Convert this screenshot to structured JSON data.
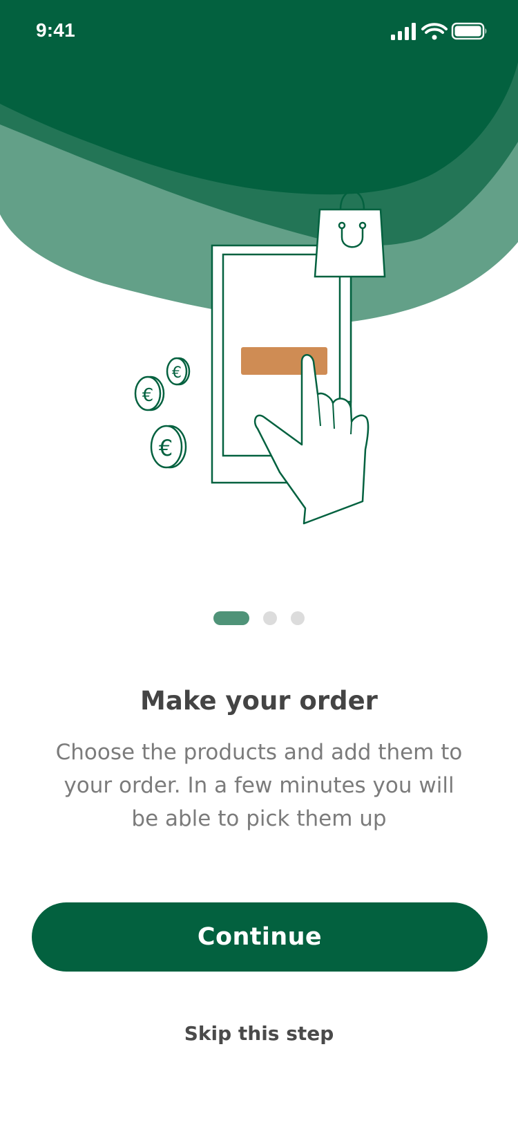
{
  "status_bar": {
    "time": "9:41",
    "icons": [
      "cellular-signal-icon",
      "wifi-icon",
      "battery-icon"
    ]
  },
  "onboarding": {
    "illustration": {
      "name": "phone-shopping-illustration",
      "elements": [
        "phone-icon",
        "shopping-bag-icon",
        "pointing-hand-icon",
        "euro-coin-icon"
      ]
    },
    "pager": {
      "total_pages": 3,
      "current_page": 1
    },
    "title": "Make your order",
    "description": "Choose the products and add them to your order. In a few minutes you will be able to pick them up",
    "continue_label": "Continue",
    "skip_label": "Skip this step"
  },
  "colors": {
    "brand_dark_green": "#03613f",
    "mid_green": "#237556",
    "light_green": "#63a088",
    "pager_active": "#4f9378",
    "pager_inactive": "#dcdcdc",
    "accent_orange": "#cf8c54",
    "title_text": "#444444",
    "body_text": "#7b7b7b"
  }
}
